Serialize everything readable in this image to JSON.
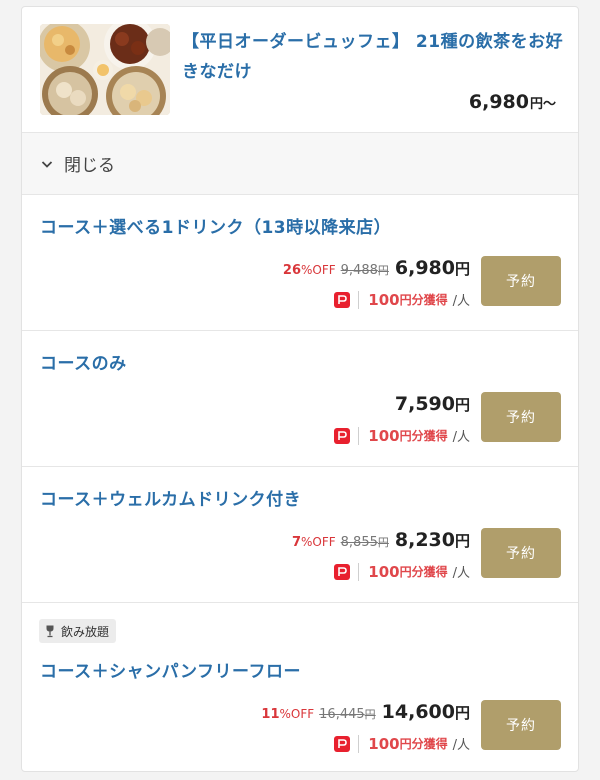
{
  "header": {
    "title": "【平日オーダービュッフェ】 21種の飲茶をお好きなだけ",
    "price": "6,980",
    "price_suffix": "円〜"
  },
  "toggle": {
    "label": "閉じる"
  },
  "plans": [
    {
      "title": "コース＋選べる1ドリンク（13時以降来店）",
      "discount_pct": "26",
      "discount_off": "%OFF",
      "original_price": "9,488",
      "price": "6,980",
      "yen": "円",
      "points": "100",
      "points_unit": "円分獲得",
      "per": "/人",
      "reserve_label": "予約"
    },
    {
      "title": "コースのみ",
      "price": "7,590",
      "yen": "円",
      "points": "100",
      "points_unit": "円分獲得",
      "per": "/人",
      "reserve_label": "予約"
    },
    {
      "title": "コース＋ウェルカムドリンク付き",
      "discount_pct": "7",
      "discount_off": "%OFF",
      "original_price": "8,855",
      "price": "8,230",
      "yen": "円",
      "points": "100",
      "points_unit": "円分獲得",
      "per": "/人",
      "reserve_label": "予約"
    },
    {
      "badge": "飲み放題",
      "title": "コース＋シャンパンフリーフロー",
      "discount_pct": "11",
      "discount_off": "%OFF",
      "original_price": "16,445",
      "price": "14,600",
      "yen": "円",
      "points": "100",
      "points_unit": "円分獲得",
      "per": "/人",
      "reserve_label": "予約"
    }
  ],
  "icons": {
    "toggle": "chevron-down-icon",
    "badge": "wine-glass-icon",
    "points": "paypay-icon"
  },
  "colors": {
    "link_blue": "#2a6ea8",
    "discount_red": "#d9363a",
    "points_red": "#e0474b",
    "reserve_gold": "#b09e6b"
  }
}
